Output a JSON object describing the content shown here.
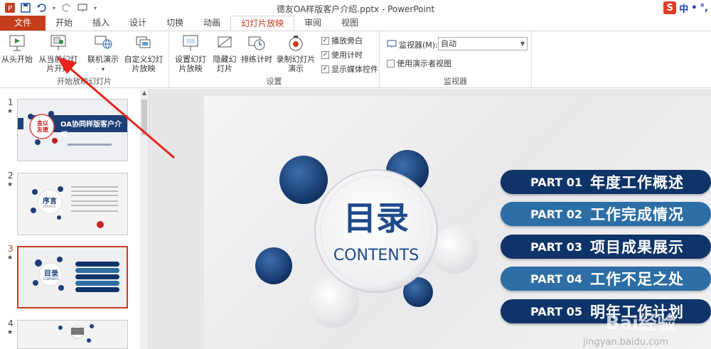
{
  "titlebar": {
    "doc_title": "德友OA样版客户介绍.pptx - PowerPoint",
    "ime": {
      "zh": "中",
      "dot": "•",
      "punct": "°,"
    }
  },
  "tabs": [
    {
      "label": "文件"
    },
    {
      "label": "开始"
    },
    {
      "label": "插入"
    },
    {
      "label": "设计"
    },
    {
      "label": "切换"
    },
    {
      "label": "动画"
    },
    {
      "label": "幻灯片放映"
    },
    {
      "label": "审阅"
    },
    {
      "label": "视图"
    }
  ],
  "ribbon": {
    "start_group": {
      "label": "开始放映幻灯片",
      "from_start": "从头开始",
      "from_current": "从当前幻灯片开始",
      "online": "联机演示",
      "custom": "自定义幻灯片放映"
    },
    "setup_group": {
      "label": "设置",
      "setup": "设置幻灯片放映",
      "hide": "隐藏幻灯片",
      "rehearse": "排练计时",
      "record": "录制幻灯片演示",
      "play_narrations": "播放旁白",
      "use_timings": "使用计时",
      "show_media": "显示媒体控件"
    },
    "monitor_group": {
      "label": "监视器",
      "monitor_label": "监视器(M):",
      "monitor_value": "自动",
      "presenter_view": "使用演示者视图"
    }
  },
  "thumbnails": [
    {
      "num": "1",
      "star": "★",
      "title": "OA协同样版客户介绍",
      "seal": "金以友德"
    },
    {
      "num": "2",
      "star": "★",
      "title": "序言",
      "sub": "PREFACE"
    },
    {
      "num": "3",
      "star": "★",
      "title": "目录",
      "sub": "CONTENTS"
    },
    {
      "num": "4",
      "star": "★"
    }
  ],
  "slide": {
    "title": "目录",
    "subtitle": "CONTENTS",
    "items": [
      {
        "part": "PART 01",
        "title": "年度工作概述"
      },
      {
        "part": "PART 02",
        "title": "工作完成情况"
      },
      {
        "part": "PART 03",
        "title": "项目成果展示"
      },
      {
        "part": "PART 04",
        "title": "工作不足之处"
      },
      {
        "part": "PART 05",
        "title": "明年工作计划"
      }
    ]
  },
  "watermark": {
    "brand": "Bai经验",
    "url": "jingyan.baidu.com"
  },
  "colors": {
    "accent": "#c43e1c",
    "navy": "#0f3469",
    "blue": "#2c6ea5"
  }
}
